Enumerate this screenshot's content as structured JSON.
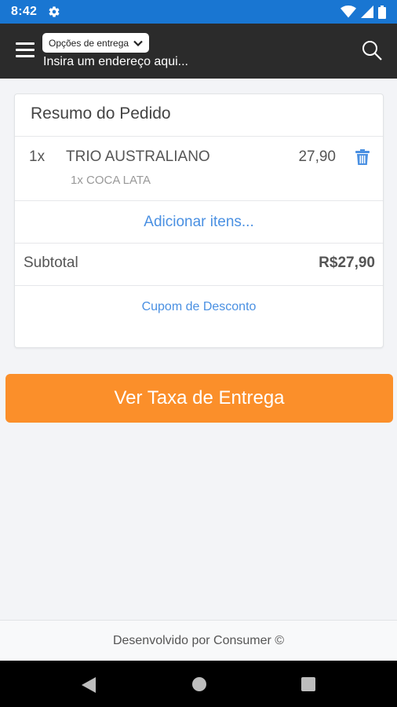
{
  "status_bar": {
    "time": "8:42",
    "icons": [
      "gear-icon",
      "wifi-icon",
      "signal-icon",
      "battery-icon"
    ]
  },
  "header": {
    "delivery_options_label": "Opções de entrega",
    "address_placeholder": "Insira um endereço aqui...",
    "icons": [
      "menu-icon",
      "chevron-down-icon",
      "search-icon"
    ]
  },
  "order_summary": {
    "title": "Resumo do Pedido",
    "items": [
      {
        "quantity": "1x",
        "name": "TRIO AUSTRALIANO",
        "price": "27,90",
        "addon": "1x COCA LATA",
        "delete_icon": "trash-icon"
      }
    ],
    "add_items_label": "Adicionar itens...",
    "subtotal_label": "Subtotal",
    "subtotal_value": "R$27,90",
    "coupon_label": "Cupom de Desconto"
  },
  "primary_action": {
    "label": "Ver Taxa de Entrega"
  },
  "footer": {
    "text": "Desenvolvido por Consumer ©"
  },
  "navigation_bar": {
    "icons": [
      "back-icon",
      "home-icon",
      "recent-apps-icon"
    ]
  },
  "colors": {
    "status_bar": "#1976d2",
    "app_bar": "#2b2b2b",
    "accent_orange": "#fb8f2a",
    "link_blue": "#4a90e2",
    "background": "#f3f4f7"
  }
}
